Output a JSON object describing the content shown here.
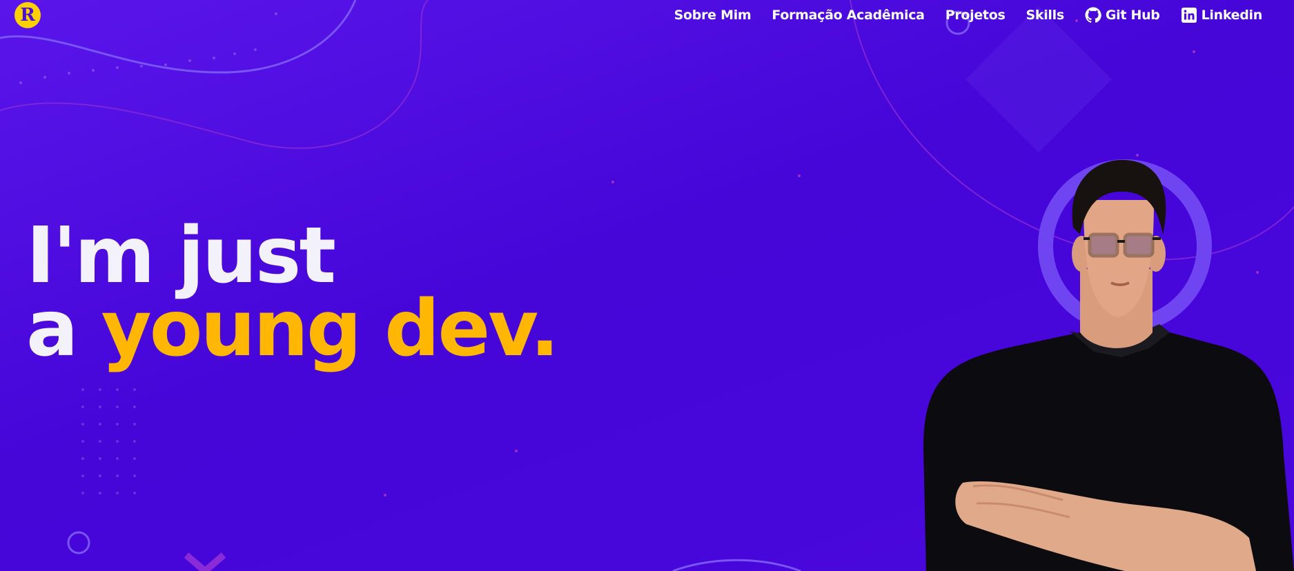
{
  "header": {
    "logo_text": "R",
    "nav": [
      {
        "label": "Sobre Mim"
      },
      {
        "label": "Formação Acadêmica"
      },
      {
        "label": "Projetos"
      },
      {
        "label": "Skills"
      },
      {
        "label": "Git Hub",
        "icon": "github-icon"
      },
      {
        "label": "Linkedin",
        "icon": "linkedin-icon"
      }
    ]
  },
  "hero": {
    "line1": "I'm just",
    "line2_prefix": "a",
    "line2_highlight": "young dev."
  },
  "colors": {
    "background": "#4a08dc",
    "accent": "#ffb703",
    "logo": "#ffd000",
    "text": "#f3f2fb"
  }
}
